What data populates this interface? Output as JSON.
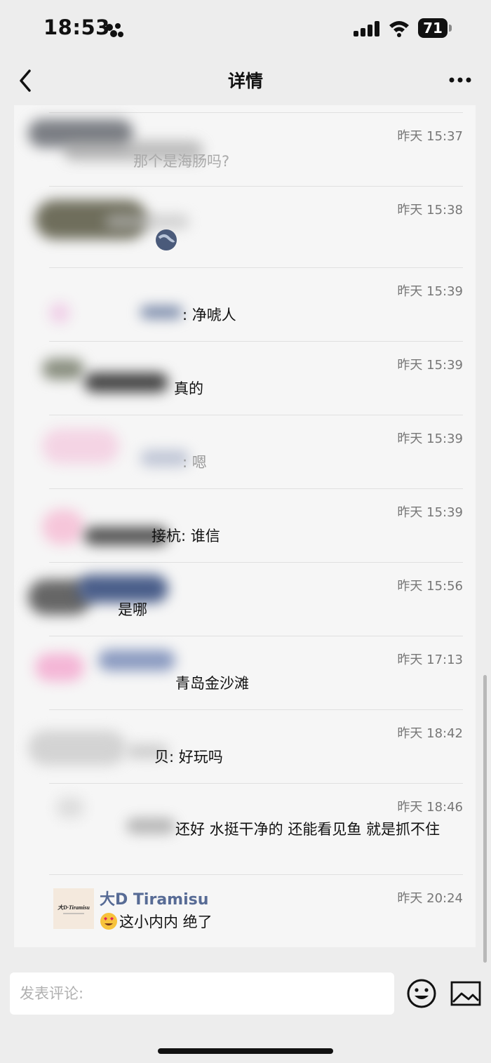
{
  "status": {
    "time": "18:53",
    "battery": "71"
  },
  "nav": {
    "title": "详情"
  },
  "comments": [
    {
      "time": "昨天 15:37",
      "text": "那个是海肠吗?"
    },
    {
      "time": "昨天 15:38",
      "text": ""
    },
    {
      "time": "昨天 15:39",
      "text": ": 净唬人"
    },
    {
      "time": "昨天 15:39",
      "text": "真的"
    },
    {
      "time": "昨天 15:39",
      "text": ": 嗯"
    },
    {
      "time": "昨天 15:39",
      "text": "接杭: 谁信"
    },
    {
      "time": "昨天 15:56",
      "text": "是哪"
    },
    {
      "time": "昨天 17:13",
      "text": "青岛金沙滩"
    },
    {
      "time": "昨天 18:42",
      "text": "贝: 好玩吗"
    },
    {
      "time": "昨天 18:46",
      "text": "还好 水挺干净的 还能看见鱼 就是抓不住"
    }
  ],
  "last_comment": {
    "name": "大D Tiramisu",
    "time": "昨天 20:24",
    "text": "这小内内 绝了",
    "avatar_text": "大D·Tiramisu"
  },
  "input": {
    "placeholder": "发表评论:"
  },
  "colors": {
    "link": "#576b95",
    "background": "#ededed",
    "panel": "#f6f6f6"
  }
}
